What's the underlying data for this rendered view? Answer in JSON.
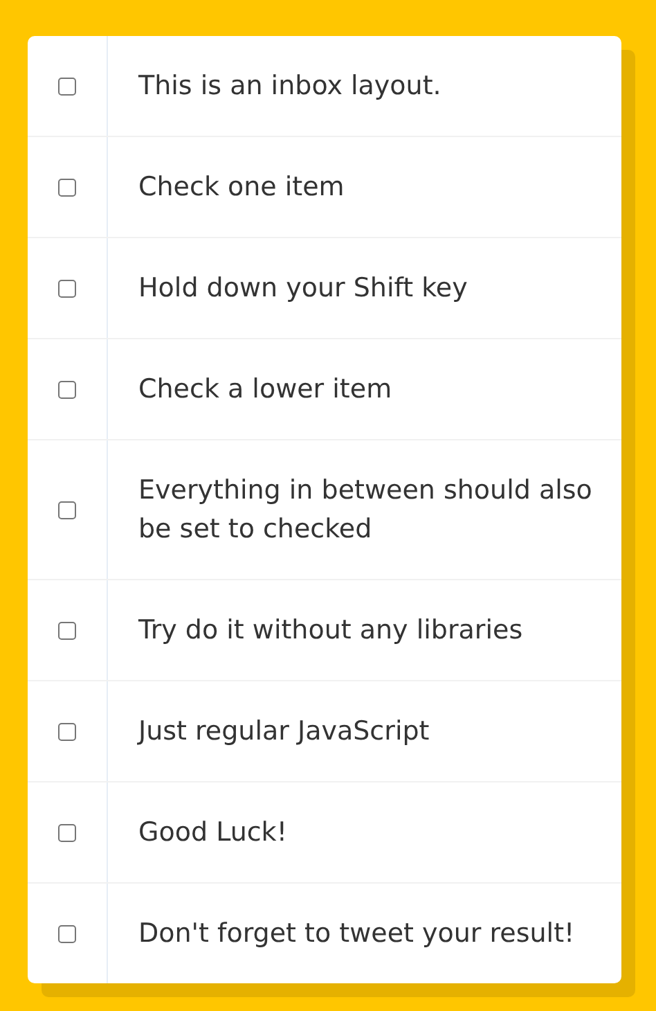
{
  "items": [
    {
      "label": "This is an inbox layout.",
      "checked": false
    },
    {
      "label": "Check one item",
      "checked": false
    },
    {
      "label": "Hold down your Shift key",
      "checked": false
    },
    {
      "label": "Check a lower item",
      "checked": false
    },
    {
      "label": "Everything in between should also be set to checked",
      "checked": false
    },
    {
      "label": "Try do it without any libraries",
      "checked": false
    },
    {
      "label": "Just regular JavaScript",
      "checked": false
    },
    {
      "label": "Good Luck!",
      "checked": false
    },
    {
      "label": "Don't forget to tweet your result!",
      "checked": false
    }
  ]
}
